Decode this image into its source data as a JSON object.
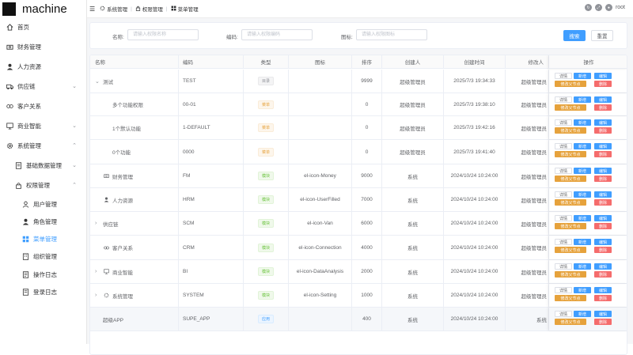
{
  "app": {
    "title": "machine"
  },
  "sidebar": {
    "items": [
      {
        "label": "首页",
        "icon": "home-icon"
      },
      {
        "label": "财务管理",
        "icon": "money-icon"
      },
      {
        "label": "人力资源",
        "icon": "user-icon"
      },
      {
        "label": "供应链",
        "icon": "van-icon"
      },
      {
        "label": "客户关系",
        "icon": "connection-icon"
      },
      {
        "label": "商业智能",
        "icon": "data-analysis-icon"
      },
      {
        "label": "系统管理",
        "icon": "setting-icon"
      },
      {
        "label": "基础数据管理",
        "icon": "document-icon"
      },
      {
        "label": "权限管理",
        "icon": "lock-icon"
      },
      {
        "label": "用户管理",
        "icon": "user-outline-icon"
      },
      {
        "label": "角色管理",
        "icon": "user-filled-icon"
      },
      {
        "label": "菜单管理",
        "icon": "menu-icon"
      },
      {
        "label": "组织管理",
        "icon": "office-icon"
      },
      {
        "label": "操作日志",
        "icon": "log-icon"
      },
      {
        "label": "登录日志",
        "icon": "login-log-icon"
      }
    ]
  },
  "header": {
    "crumbs": [
      "系统管理",
      "权限管理",
      "菜单管理"
    ],
    "user": "root"
  },
  "search": {
    "name_label": "名称:",
    "name_placeholder": "请输入权限名称",
    "code_label": "编码:",
    "code_placeholder": "请输入权限编码",
    "icon_label": "图标:",
    "icon_placeholder": "请输入权限图标",
    "search_btn": "搜索",
    "reset_btn": "重置"
  },
  "table": {
    "columns": [
      "名称",
      "编码",
      "类型",
      "图标",
      "排序",
      "创建人",
      "创建时间",
      "修改人",
      "操作"
    ],
    "actions": {
      "detail": "详情",
      "add": "新增",
      "edit": "编辑",
      "parent": "修改父节点",
      "delete": "删除"
    },
    "rows": [
      {
        "name": "测试",
        "code": "TEST",
        "type": "目录",
        "icon": "",
        "sort": "9999",
        "creator": "超级管理员",
        "time": "2025/7/3 19:34:33",
        "modifier": "超级管理员"
      },
      {
        "name": "多个功能权限",
        "code": "00-01",
        "type": "菜单",
        "icon": "",
        "sort": "0",
        "creator": "超级管理员",
        "time": "2025/7/3 19:38:10",
        "modifier": "超级管理员"
      },
      {
        "name": "1个默认功能",
        "code": "1-DEFAULT",
        "type": "菜单",
        "icon": "",
        "sort": "0",
        "creator": "超级管理员",
        "time": "2025/7/3 19:42:16",
        "modifier": "超级管理员"
      },
      {
        "name": "0个功能",
        "code": "0000",
        "type": "菜单",
        "icon": "",
        "sort": "0",
        "creator": "超级管理员",
        "time": "2025/7/3 19:41:40",
        "modifier": "超级管理员"
      },
      {
        "name": "财务管理",
        "code": "FM",
        "type": "模块",
        "icon": "el-icon-Money",
        "sort": "9000",
        "creator": "系统",
        "time": "2024/10/24 10:24:00",
        "modifier": "超级管理员"
      },
      {
        "name": "人力资源",
        "code": "HRM",
        "type": "模块",
        "icon": "el-icon-UserFilled",
        "sort": "7000",
        "creator": "系统",
        "time": "2024/10/24 10:24:00",
        "modifier": "超级管理员"
      },
      {
        "name": "供应链",
        "code": "SCM",
        "type": "模块",
        "icon": "el-icon-Van",
        "sort": "6000",
        "creator": "系统",
        "time": "2024/10/24 10:24:00",
        "modifier": "超级管理员"
      },
      {
        "name": "客户关系",
        "code": "CRM",
        "type": "模块",
        "icon": "el-icon-Connection",
        "sort": "4000",
        "creator": "系统",
        "time": "2024/10/24 10:24:00",
        "modifier": "超级管理员"
      },
      {
        "name": "商业智能",
        "code": "BI",
        "type": "模块",
        "icon": "el-icon-DataAnalysis",
        "sort": "2000",
        "creator": "系统",
        "time": "2024/10/24 10:24:00",
        "modifier": "超级管理员"
      },
      {
        "name": "系统管理",
        "code": "SYSTEM",
        "type": "模块",
        "icon": "el-icon-Setting",
        "sort": "1000",
        "creator": "系统",
        "time": "2024/10/24 10:24:00",
        "modifier": "超级管理员"
      },
      {
        "name": "超级APP",
        "code": "SUPE_APP",
        "type": "应用",
        "icon": "",
        "sort": "400",
        "creator": "系统",
        "time": "2024/10/24 10:24:00",
        "modifier": "系统"
      }
    ]
  },
  "colors": {
    "primary": "#409eff",
    "warning": "#e6a23c",
    "danger": "#f56c6c",
    "success": "#67c23a"
  }
}
